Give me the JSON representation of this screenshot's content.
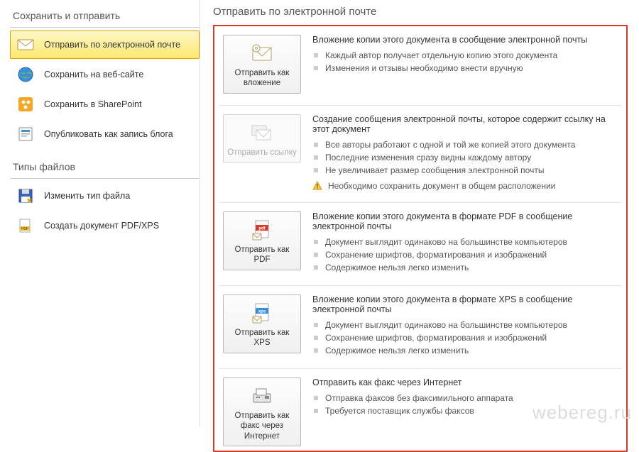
{
  "sidebar": {
    "section1_title": "Сохранить и отправить",
    "section2_title": "Типы файлов",
    "items1": [
      {
        "label": "Отправить по электронной почте"
      },
      {
        "label": "Сохранить на веб-сайте"
      },
      {
        "label": "Сохранить в SharePoint"
      },
      {
        "label": "Опубликовать как запись блога"
      }
    ],
    "items2": [
      {
        "label": "Изменить тип файла"
      },
      {
        "label": "Создать документ PDF/XPS"
      }
    ]
  },
  "main": {
    "title": "Отправить по электронной почте",
    "options": [
      {
        "btn_label": "Отправить как вложение",
        "heading": "Вложение копии этого документа в сообщение электронной почты",
        "bullets": [
          "Каждый автор получает отдельную копию этого документа",
          "Изменения и отзывы необходимо внести вручную"
        ]
      },
      {
        "btn_label": "Отправить ссылку",
        "heading": "Создание сообщения электронной почты, которое содержит ссылку на этот документ",
        "bullets": [
          "Все авторы работают с одной и той же копией этого документа",
          "Последние изменения сразу видны каждому автору",
          "Не увеличивает размер сообщения электронной почты"
        ],
        "warn": "Необходимо сохранить документ в общем расположении"
      },
      {
        "btn_label": "Отправить как PDF",
        "heading": "Вложение копии этого документа в формате PDF в сообщение электронной почты",
        "bullets": [
          "Документ выглядит одинаково на большинстве компьютеров",
          "Сохранение шрифтов, форматирования и изображений",
          "Содержимое нельзя легко изменить"
        ]
      },
      {
        "btn_label": "Отправить как XPS",
        "heading": "Вложение копии этого документа в формате XPS в сообщение электронной почты",
        "bullets": [
          "Документ выглядит одинаково на большинстве компьютеров",
          "Сохранение шрифтов, форматирования и изображений",
          "Содержимое нельзя легко изменить"
        ]
      },
      {
        "btn_label": "Отправить как факс через Интернет",
        "heading": "Отправить как факс через Интернет",
        "bullets": [
          "Отправка факсов без факсимильного аппарата",
          "Требуется поставщик службы факсов"
        ]
      }
    ]
  },
  "watermark": "webereg.ru"
}
